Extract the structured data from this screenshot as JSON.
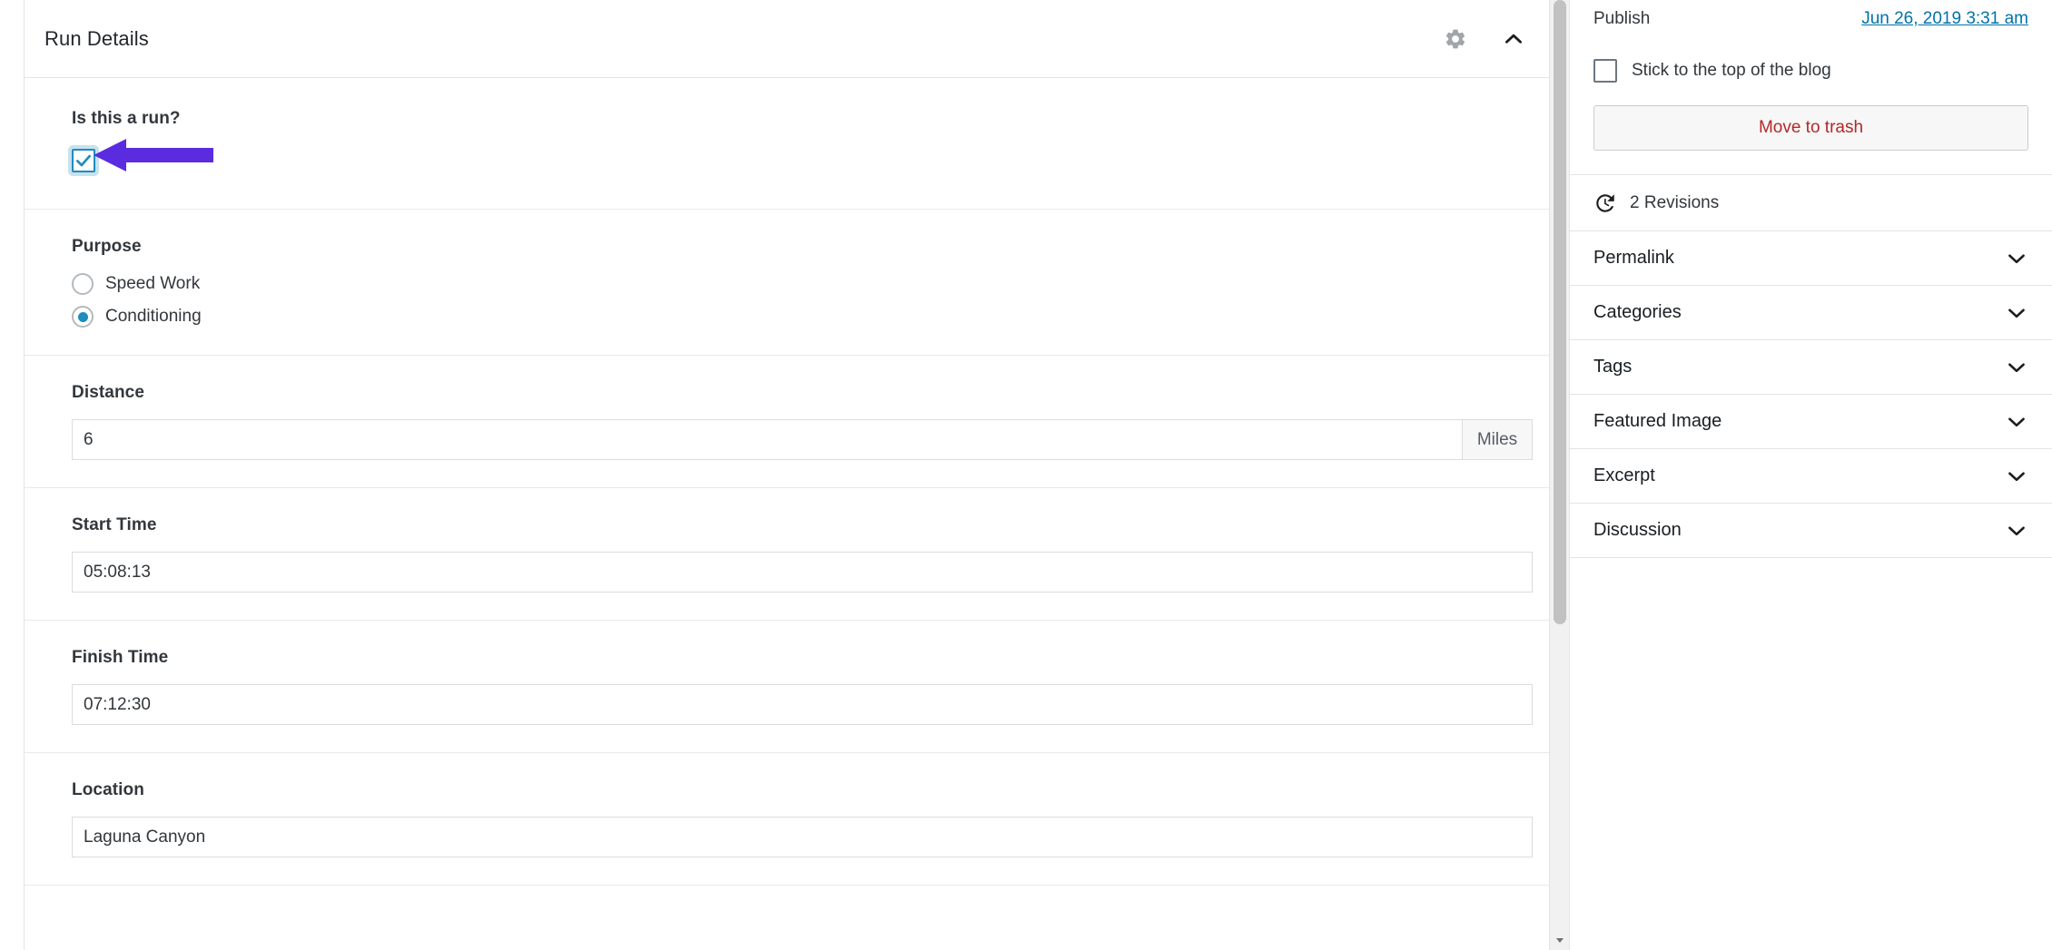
{
  "metabox": {
    "title": "Run Details",
    "gear_icon": "gear-icon",
    "collapse_icon": "chevron-up-icon",
    "fields": {
      "is_run": {
        "label": "Is this a run?",
        "checked": true,
        "check_icon": "check-icon"
      },
      "purpose": {
        "label": "Purpose",
        "options": [
          {
            "label": "Speed Work",
            "selected": false
          },
          {
            "label": "Conditioning",
            "selected": true
          }
        ]
      },
      "distance": {
        "label": "Distance",
        "value": "6",
        "placeholder": "",
        "unit": "Miles"
      },
      "start_time": {
        "label": "Start Time",
        "value": "05:08:13",
        "placeholder": ""
      },
      "finish_time": {
        "label": "Finish Time",
        "value": "07:12:30",
        "placeholder": ""
      },
      "location": {
        "label": "Location",
        "value": "Laguna Canyon",
        "placeholder": ""
      }
    },
    "annotation": {
      "type": "arrow",
      "points_to": "is-this-a-run-checkbox",
      "color": "#5b2be0"
    }
  },
  "sidebar": {
    "publish": {
      "label": "Publish",
      "date": "Jun 26, 2019 3:31 am",
      "sticky": {
        "label": "Stick to the top of the blog",
        "checked": false
      },
      "trash_label": "Move to trash"
    },
    "revisions": {
      "label": "2 Revisions",
      "icon": "history-clock-icon"
    },
    "panels": [
      {
        "label": "Permalink",
        "icon": "chevron-down-icon"
      },
      {
        "label": "Categories",
        "icon": "chevron-down-icon"
      },
      {
        "label": "Tags",
        "icon": "chevron-down-icon"
      },
      {
        "label": "Featured Image",
        "icon": "chevron-down-icon"
      },
      {
        "label": "Excerpt",
        "icon": "chevron-down-icon"
      },
      {
        "label": "Discussion",
        "icon": "chevron-down-icon"
      }
    ]
  },
  "colors": {
    "link": "#0073aa",
    "danger": "#b52727",
    "accent_checkbox": "#1e8cbe",
    "annotation": "#5b2be0"
  }
}
